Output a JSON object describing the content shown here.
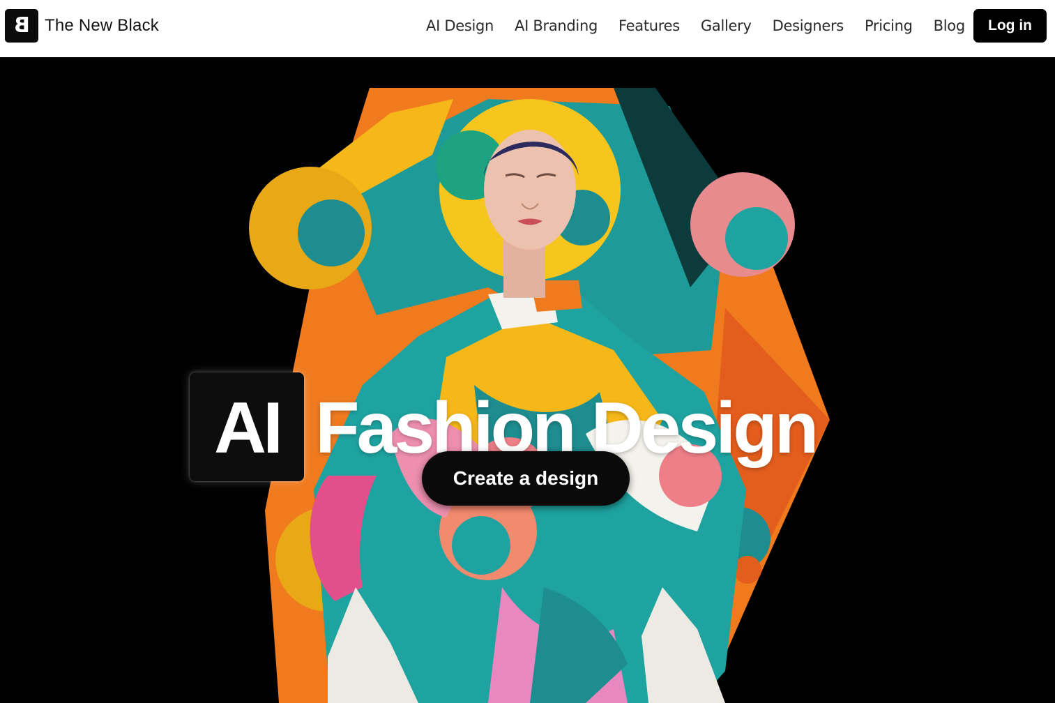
{
  "brand": {
    "logo_letter": "B",
    "name": "The New Black"
  },
  "nav": {
    "items": [
      "AI Design",
      "AI Branding",
      "Features",
      "Gallery",
      "Designers",
      "Pricing",
      "Blog"
    ],
    "login_label": "Log in"
  },
  "hero": {
    "title_badge": "AI",
    "title_rest": "Fashion Design",
    "cta_label": "Create a design"
  },
  "colors": {
    "orange": "#f07a1e",
    "teal": "#1fa3a0",
    "yellow": "#f6b818",
    "pink": "#ee7f88"
  }
}
